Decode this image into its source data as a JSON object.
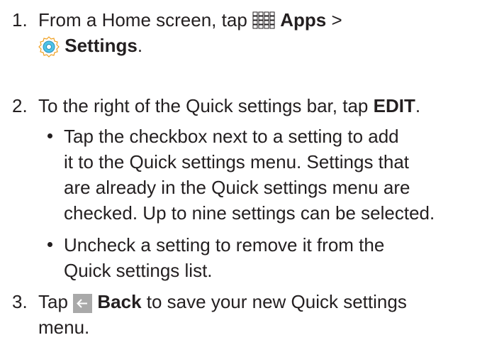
{
  "steps": [
    {
      "number": "1.",
      "line1_pre": "From a Home screen, tap ",
      "apps_label": "Apps",
      "separator": " >",
      "settings_label": "Settings",
      "line2_post": "."
    },
    {
      "number": "2.",
      "pre": "To the right of the Quick settings bar, tap ",
      "edit_label": "EDIT",
      "post": ".",
      "bullets": [
        {
          "lines": [
            "Tap the checkbox next to a setting to add",
            "it to the Quick settings menu. Settings that",
            "are already in the Quick settings menu are",
            "checked. Up to nine settings can be selected."
          ]
        },
        {
          "lines": [
            "Uncheck a setting to remove it from the",
            "Quick settings list."
          ]
        }
      ]
    },
    {
      "number": "3.",
      "pre": "Tap ",
      "back_label": "Back",
      "line1_post": " to save your new Quick settings",
      "line2": "menu."
    }
  ],
  "icons": {
    "apps": "apps-grid-icon",
    "settings": "settings-gear-icon",
    "back": "back-arrow-icon"
  },
  "colors": {
    "text": "#231f20",
    "settings_icon": "#4fc3e8",
    "back_icon_bg": "#a9a9a9"
  }
}
